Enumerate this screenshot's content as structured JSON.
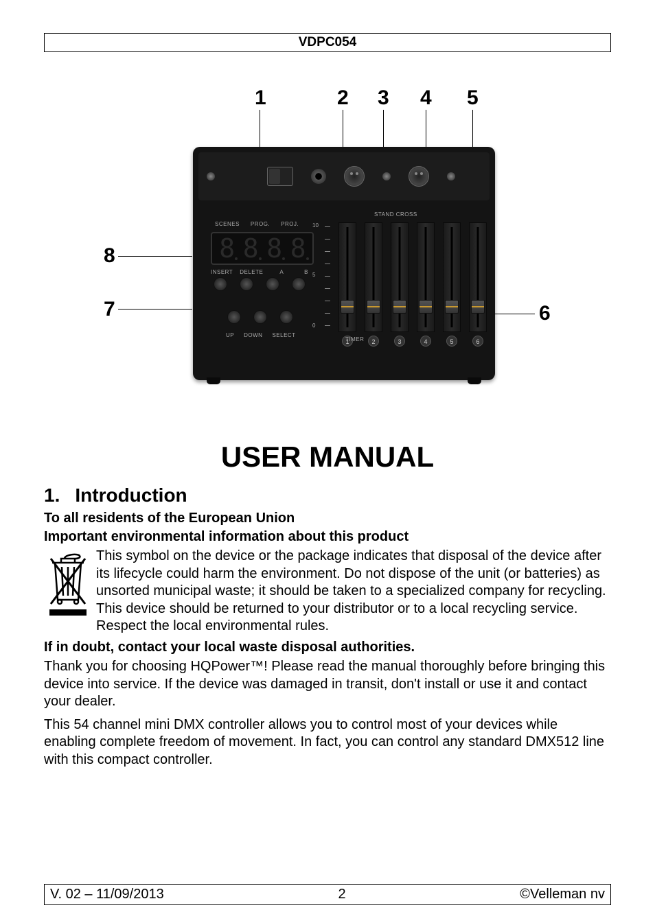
{
  "header": {
    "title": "VDPC054"
  },
  "diagram": {
    "callouts": [
      "1",
      "2",
      "3",
      "4",
      "5",
      "6",
      "7",
      "8"
    ],
    "device": {
      "stand_cross": "STAND  CROSS",
      "scenes_labels": [
        "SCENES",
        "PROG.",
        "PROJ."
      ],
      "top_btn_labels": [
        "INSERT",
        "DELETE",
        "A",
        "B"
      ],
      "bottom_btn_labels": [
        "UP",
        "DOWN",
        "SELECT"
      ],
      "scale": {
        "top": "10",
        "mid": "5",
        "bottom": "0"
      },
      "timer": "TIMER",
      "fader_numbers": [
        "1",
        "2",
        "3",
        "4",
        "5",
        "6"
      ]
    }
  },
  "doc_title": "USER MANUAL",
  "section1": {
    "num": "1.",
    "title": "Introduction",
    "sub1": "To all residents of the European Union",
    "sub2": "Important environmental information about this product",
    "weee_text": "This symbol on the device or the package indicates that disposal of the device after its lifecycle could harm the environment. Do not dispose of the unit (or batteries) as unsorted municipal waste; it should be taken to a specialized company for recycling. This device should be returned to your distributor or to a local recycling service. Respect the local environmental rules.",
    "sub3": "If in doubt, contact your local waste disposal authorities.",
    "para1": "Thank you for choosing HQPower™! Please read the manual thoroughly before bringing this device into service. If the device was damaged in transit, don't install or use it and contact your dealer.",
    "para2": "This 54 channel mini DMX controller allows you to control most of your devices while enabling complete freedom of movement. In fact, you can control any standard DMX512 line with this compact controller."
  },
  "footer": {
    "version": "V. 02 – 11/09/2013",
    "page": "2",
    "copyright": "©Velleman nv"
  }
}
